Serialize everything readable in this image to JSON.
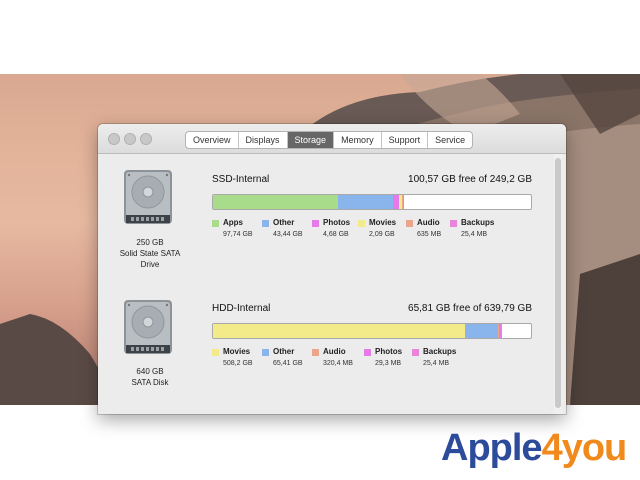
{
  "window": {
    "tabs": [
      {
        "label": "Overview",
        "active": false
      },
      {
        "label": "Displays",
        "active": false
      },
      {
        "label": "Storage",
        "active": true
      },
      {
        "label": "Memory",
        "active": false
      },
      {
        "label": "Support",
        "active": false
      },
      {
        "label": "Service",
        "active": false
      }
    ]
  },
  "disks": [
    {
      "name": "SSD-Internal",
      "free_text": "100,57 GB free of 249,2 GB",
      "caption": [
        "250 GB",
        "Solid State SATA",
        "Drive"
      ],
      "usage_fractions": [
        {
          "category": "Apps",
          "fraction": 0.392
        },
        {
          "category": "Other",
          "fraction": 0.174
        },
        {
          "category": "Photos",
          "fraction": 0.019
        },
        {
          "category": "Movies",
          "fraction": 0.008
        },
        {
          "category": "Audio",
          "fraction": 0.003
        },
        {
          "category": "Backups",
          "fraction": 0.003
        }
      ],
      "legend": [
        {
          "label": "Apps",
          "value": "97,74 GB",
          "color": "#a8dc8a"
        },
        {
          "label": "Other",
          "value": "43,44 GB",
          "color": "#8ab4ec"
        },
        {
          "label": "Photos",
          "value": "4,68 GB",
          "color": "#e67ae8"
        },
        {
          "label": "Movies",
          "value": "2,09 GB",
          "color": "#f3ea8a"
        },
        {
          "label": "Audio",
          "value": "635 MB",
          "color": "#eba58a"
        },
        {
          "label": "Backups",
          "value": "25,4 MB",
          "color": "#e884d9"
        }
      ]
    },
    {
      "name": "HDD-Internal",
      "free_text": "65,81 GB free of 639,79 GB",
      "caption": [
        "640 GB",
        "SATA Disk"
      ],
      "usage_fractions": [
        {
          "category": "Movies",
          "fraction": 0.794
        },
        {
          "category": "Other",
          "fraction": 0.102
        },
        {
          "category": "Audio",
          "fraction": 0.0005
        },
        {
          "category": "Photos",
          "fraction": 0.006
        },
        {
          "category": "Backups",
          "fraction": 0.004
        }
      ],
      "legend": [
        {
          "label": "Movies",
          "value": "508,2 GB",
          "color": "#f3ea8a"
        },
        {
          "label": "Other",
          "value": "65,41 GB",
          "color": "#8ab4ec"
        },
        {
          "label": "Audio",
          "value": "320,4 MB",
          "color": "#eba58a"
        },
        {
          "label": "Photos",
          "value": "29,3 MB",
          "color": "#e67ae8"
        },
        {
          "label": "Backups",
          "value": "25,4 MB",
          "color": "#e884d9"
        }
      ]
    }
  ],
  "watermark": {
    "part1": "Apple",
    "part2": "4you"
  }
}
